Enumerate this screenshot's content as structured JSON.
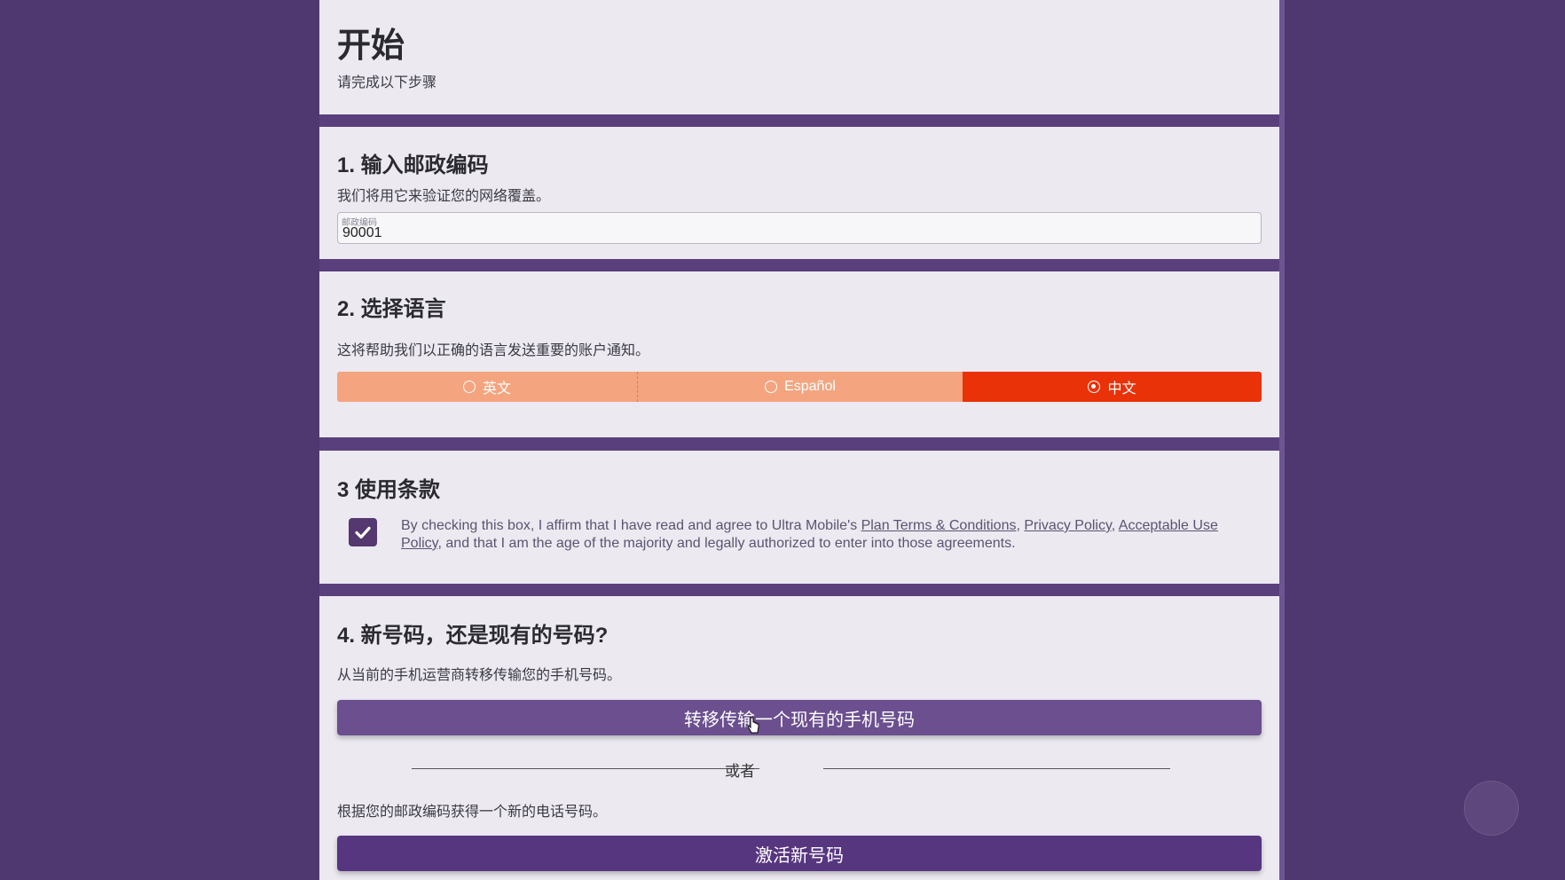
{
  "header": {
    "title": "开始",
    "subtitle": "请完成以下步骤"
  },
  "step1": {
    "title": "1. 输入邮政编码",
    "description": "我们将用它来验证您的网络覆盖。",
    "zip_label": "邮政编码",
    "zip_value": "90001"
  },
  "step2": {
    "title": "2. 选择语言",
    "description": "这将帮助我们以正确的语言发送重要的账户通知。",
    "options": [
      {
        "label": "英文",
        "selected": false
      },
      {
        "label": "Español",
        "selected": false
      },
      {
        "label": "中文",
        "selected": true
      }
    ],
    "colors": {
      "unselected": "#f4a57f",
      "selected": "#ea3209"
    }
  },
  "step3": {
    "title": "3 使用条款",
    "checked": true,
    "text_before": "By checking this box, I affirm that I have read and agree to Ultra Mobile's ",
    "link_terms": "Plan Terms & Conditions",
    "sep1": ", ",
    "link_privacy": "Privacy Policy",
    "sep2": ", ",
    "link_aup": "Acceptable Use Policy",
    "text_after": ", and that I am the age of the majority and legally authorized to enter into those agreements."
  },
  "step4": {
    "title": "4. 新号码，还是现有的号码?",
    "transfer_description": "从当前的手机运营商转移传输您的手机号码。",
    "transfer_button": "转移传输一个现有的手机号码",
    "or_text": "或者",
    "new_description": "根据您的邮政编码获得一个新的电话号码。",
    "new_button": "激活新号码"
  },
  "icons": {
    "checkbox": "check-icon",
    "cursor": "hand-pointer-icon",
    "radio": "radio-icon"
  },
  "colors": {
    "background": "#4f3770",
    "card": "#ece9f1",
    "button_primary": "#573680"
  }
}
